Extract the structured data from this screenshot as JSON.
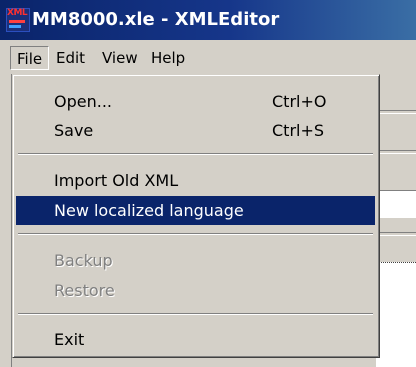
{
  "window": {
    "title": "MM8000.xle - XMLEditor",
    "icon": "xml-app-icon",
    "icon_text": "XML"
  },
  "menubar": {
    "items": [
      {
        "label": "File",
        "open": true
      },
      {
        "label": "Edit"
      },
      {
        "label": "View"
      },
      {
        "label": "Help"
      }
    ]
  },
  "file_menu": {
    "items": [
      {
        "label": "Open...",
        "shortcut": "Ctrl+O",
        "enabled": true
      },
      {
        "label": "Save",
        "shortcut": "Ctrl+S",
        "enabled": true
      },
      {
        "label": "Import Old XML",
        "enabled": true
      },
      {
        "label": "New localized language",
        "enabled": true,
        "highlighted": true
      },
      {
        "label": "Backup",
        "enabled": false
      },
      {
        "label": "Restore",
        "enabled": false
      },
      {
        "label": "Exit",
        "enabled": true
      }
    ]
  },
  "colors": {
    "titlebar": "#0a246a",
    "highlight": "#0a246a",
    "face": "#d4d0c8",
    "disabled_text": "#808080"
  }
}
